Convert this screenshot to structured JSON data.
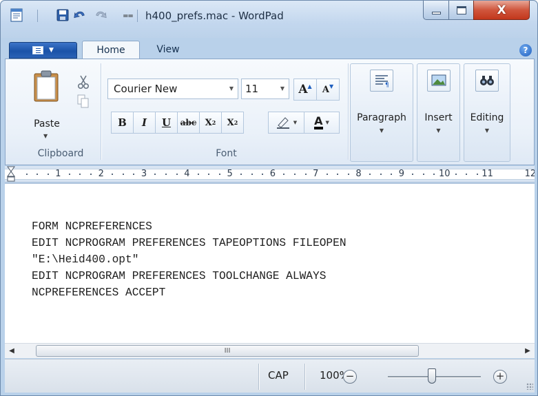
{
  "window": {
    "title": "h400_prefs.mac - WordPad",
    "qat_menu_glyph": "⩵",
    "minimize_glyph": "",
    "close_glyph": "X"
  },
  "ribbon": {
    "tabs": [
      {
        "label": "Home",
        "active": true
      },
      {
        "label": "View",
        "active": false
      }
    ],
    "help_glyph": "?",
    "clipboard": {
      "label": "Clipboard",
      "paste_label": "Paste"
    },
    "font": {
      "label": "Font",
      "font_name": "Courier New",
      "font_size": "11",
      "grow_label": "A",
      "shrink_label": "A",
      "bold_label": "B",
      "italic_label": "I",
      "underline_label": "U",
      "strike_label": "abc",
      "subscript_label": "X",
      "superscript_label": "X",
      "font_color_label": "A",
      "font_color": "#000000",
      "highlight_color": "#ffffff"
    },
    "groups": [
      {
        "label": "Paragraph",
        "icon": "paragraph-icon"
      },
      {
        "label": "Insert",
        "icon": "picture-icon"
      },
      {
        "label": "Editing",
        "icon": "find-icon"
      }
    ]
  },
  "ruler": {
    "numbers": [
      "1",
      "2",
      "3",
      "4",
      "5",
      "6",
      "7",
      "8",
      "9",
      "10",
      "11",
      "12"
    ]
  },
  "document": {
    "lines": [
      "FORM NCPREFERENCES",
      "EDIT NCPROGRAM PREFERENCES TAPEOPTIONS FILEOPEN",
      "\"E:\\Heid400.opt\"",
      "EDIT NCPROGRAM PREFERENCES TOOLCHANGE ALWAYS",
      "NCPREFERENCES ACCEPT"
    ]
  },
  "scrollbar": {
    "thumb_grip": "III"
  },
  "status_bar": {
    "caps": "CAP",
    "zoom": "100%",
    "zoom_out_glyph": "−",
    "zoom_in_glyph": "+"
  },
  "colors": {
    "title_bar": "#c3d7ee",
    "file_menu": "#1b53a8",
    "close_button": "#c2371c"
  }
}
